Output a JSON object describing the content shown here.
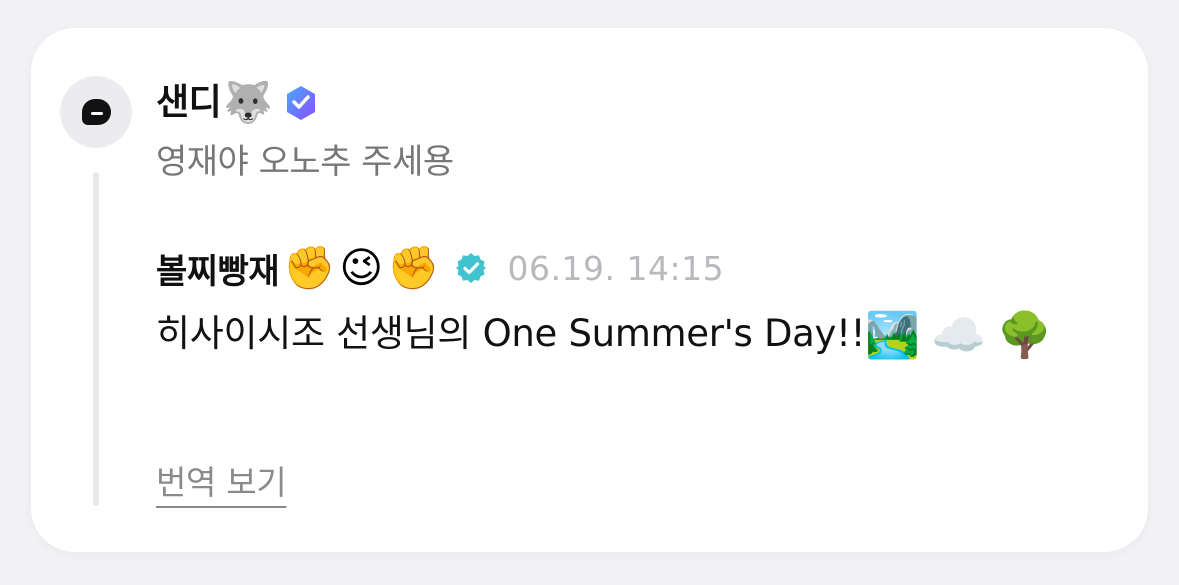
{
  "post": {
    "author": {
      "name": "샌디",
      "emoji": "🐺",
      "badge_icon": "purple-heart-check-badge-icon",
      "badge_color": "#6c63ff"
    },
    "text": "영재야 오노추 주세용"
  },
  "quote": {
    "author": {
      "name": "볼찌빵재",
      "emojis": [
        "✊",
        "😉",
        "✊"
      ],
      "badge_icon": "teal-verified-badge-icon",
      "badge_color": "#3fc4cf"
    },
    "timestamp": "06.19. 14:15",
    "text": "히사이시조 선생님의 One Summer's Day!!",
    "trailing_emojis": [
      "🏞️",
      "☁️",
      "🌳"
    ],
    "translate_label": "번역 보기"
  },
  "colors": {
    "page_background": "#f2f2f4",
    "card_background": "#ffffff",
    "muted_text": "#777777",
    "timestamp_text": "#b9b9bd"
  }
}
